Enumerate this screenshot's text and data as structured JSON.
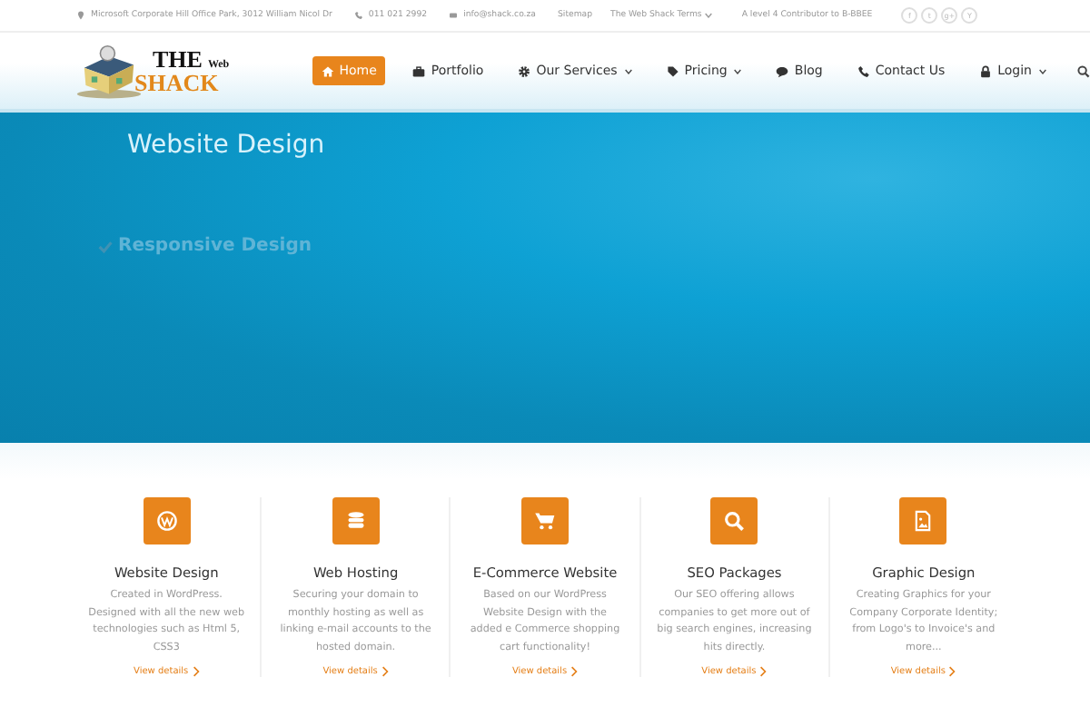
{
  "top_bar": {
    "address": "Microsoft Corporate Hill Office Park, 3012 William Nicol Dr",
    "phone": "011 021 2992",
    "email": "info@shack.co.za",
    "links": [
      {
        "label": "Sitemap",
        "dropdown": false
      },
      {
        "label": "The Web Shack Terms",
        "dropdown": true
      }
    ],
    "bee_level": "A level 4 Contributor to B-BBEE",
    "social": [
      {
        "glyph": "f"
      },
      {
        "glyph": "t"
      },
      {
        "glyph": "g+"
      },
      {
        "glyph": "Y"
      }
    ]
  },
  "logo": {
    "the": "THE",
    "web": "Web",
    "shack": "SHACK"
  },
  "nav": [
    {
      "label": "Home",
      "selected": true,
      "dropdown": false
    },
    {
      "label": "Portfolio",
      "selected": false,
      "dropdown": false
    },
    {
      "label": "Our Services",
      "selected": false,
      "dropdown": true
    },
    {
      "label": "Pricing",
      "selected": false,
      "dropdown": true
    },
    {
      "label": "Blog",
      "selected": false,
      "dropdown": false
    },
    {
      "label": "Contact Us",
      "selected": false,
      "dropdown": false
    },
    {
      "label": "Login",
      "selected": false,
      "dropdown": true
    }
  ],
  "hero": {
    "title": "Website Design",
    "feature": "Responsive Design"
  },
  "services": [
    {
      "title": "Website Design",
      "text": "Created in WordPress. Designed with all the new web technologies such as Html 5, CSS3",
      "link": "View details"
    },
    {
      "title": "Web Hosting",
      "text": "Securing your domain to monthly hosting as well as linking e-mail accounts to the hosted domain.",
      "link": "View details"
    },
    {
      "title": "E-Commerce Website",
      "text": "Based on our WordPress Website Design with the added e Commerce shopping cart functionality!",
      "link": "View details"
    },
    {
      "title": "SEO Packages",
      "text": "Our SEO offering allows companies to get more out of big search engines, increasing hits directly.",
      "link": "View details"
    },
    {
      "title": "Graphic Design",
      "text": "Creating Graphics for your Company Corporate Identity; from Logo's to Invoice's and more...",
      "link": "View details"
    }
  ]
}
